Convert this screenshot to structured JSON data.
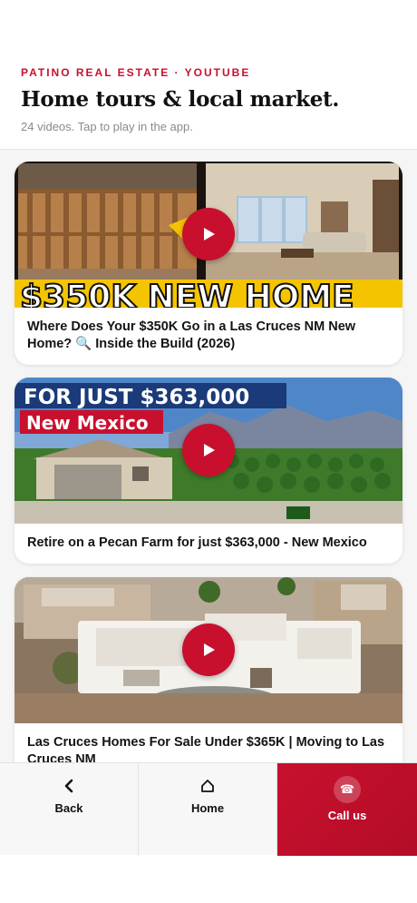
{
  "header": {
    "eyebrow": "PATINO REAL ESTATE · YOUTUBE",
    "title": "Home tours & local market.",
    "subtitle": "24 videos. Tap to play in the app."
  },
  "videos": [
    {
      "title": "Where Does Your $350K Go in a Las Cruces NM New Home? 🔍 Inside the Build (2026)",
      "thumb_text": "$350K NEW HOME"
    },
    {
      "title": "Retire on a Pecan Farm for just $363,000 - New Mexico",
      "thumb_text_top": "FOR JUST $363,000",
      "thumb_text_bottom": "New Mexico"
    },
    {
      "title": "Las Cruces Homes For Sale Under $365K | Moving to Las Cruces NM"
    }
  ],
  "nav": {
    "back_label": "Back",
    "home_label": "Home",
    "call_label": "Call us"
  },
  "colors": {
    "accent": "#c8102e"
  }
}
